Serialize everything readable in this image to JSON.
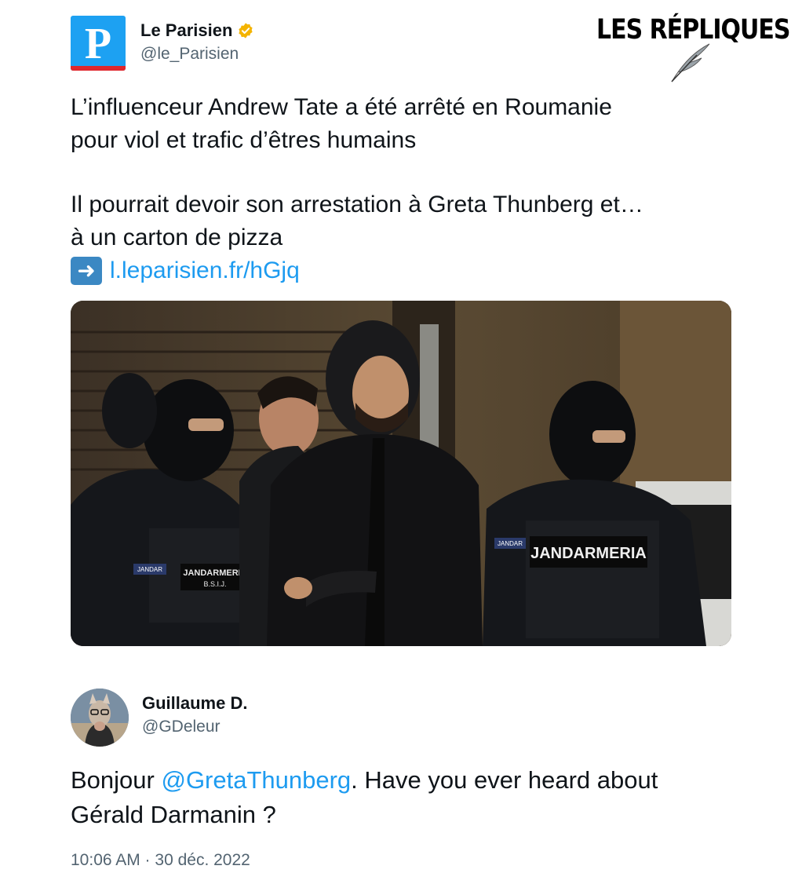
{
  "author": {
    "name": "Le Parisien",
    "handle": "@le_Parisien",
    "logo_letter": "P",
    "verified": true,
    "verified_color": "#f4b400"
  },
  "watermark": {
    "text": "LES RÉPLIQUES"
  },
  "tweet": {
    "line1": "L’influenceur Andrew Tate a été arrêté en Roumanie",
    "line2": "pour viol et trafic d’êtres humains",
    "line3": "Il pourrait devoir son arrestation à Greta Thunberg et…",
    "line4": "à un carton de pizza",
    "link_icon": "arrow-right-icon",
    "link": "l.leparisien.fr/hGjq"
  },
  "photo": {
    "vest_label_left": "JANDARMERIA",
    "vest_sub_left": "B.S.I.J.",
    "vest_label_right": "JANDARMERIA",
    "patch_left": "JANDAR",
    "patch_right": "JANDAR"
  },
  "reply": {
    "name": "Guillaume D.",
    "handle": "@GDeleur",
    "text_before": "Bonjour ",
    "mention": "@GretaThunberg",
    "text_after": ". Have you ever heard about",
    "line2": "Gérald Darmanin ?"
  },
  "timestamp": "10:06 AM · 30 déc. 2022",
  "colors": {
    "link": "#1d9bf0",
    "secondary_text": "#536471",
    "logo_bg": "#1da1f2",
    "logo_stripe": "#e0262c"
  }
}
